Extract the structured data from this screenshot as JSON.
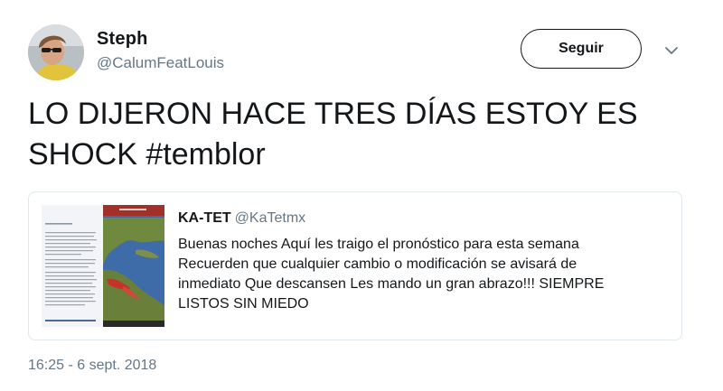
{
  "tweet": {
    "author": {
      "name": "Steph",
      "handle": "@CalumFeatLouis"
    },
    "follow_label": "Seguir",
    "text_line1": "LO DIJERON HACE TRES DÍAS ESTOY ES",
    "text_line2": "SHOCK #temblor",
    "timestamp": "16:25 - 6 sept. 2018"
  },
  "quoted_tweet": {
    "name": "KA-TET",
    "handle": "@KaTetmx",
    "line1": "Buenas noches Aquí les traigo el pronóstico para esta semana",
    "line2": "Recuerden que cualquier cambio o modificación se avisará de",
    "line3": "inmediato Que descansen Les mando un gran abrazo!!! SIEMPRE",
    "line4": "LISTOS SIN MIEDO"
  },
  "colors": {
    "text_primary": "#14171a",
    "text_secondary": "#657786",
    "border": "#e1e8ed",
    "map_sea": "#3d6ca8",
    "map_land": "#6f8a3e",
    "map_header": "#a03028"
  },
  "icons": {
    "caret": "chevron-down-icon"
  }
}
